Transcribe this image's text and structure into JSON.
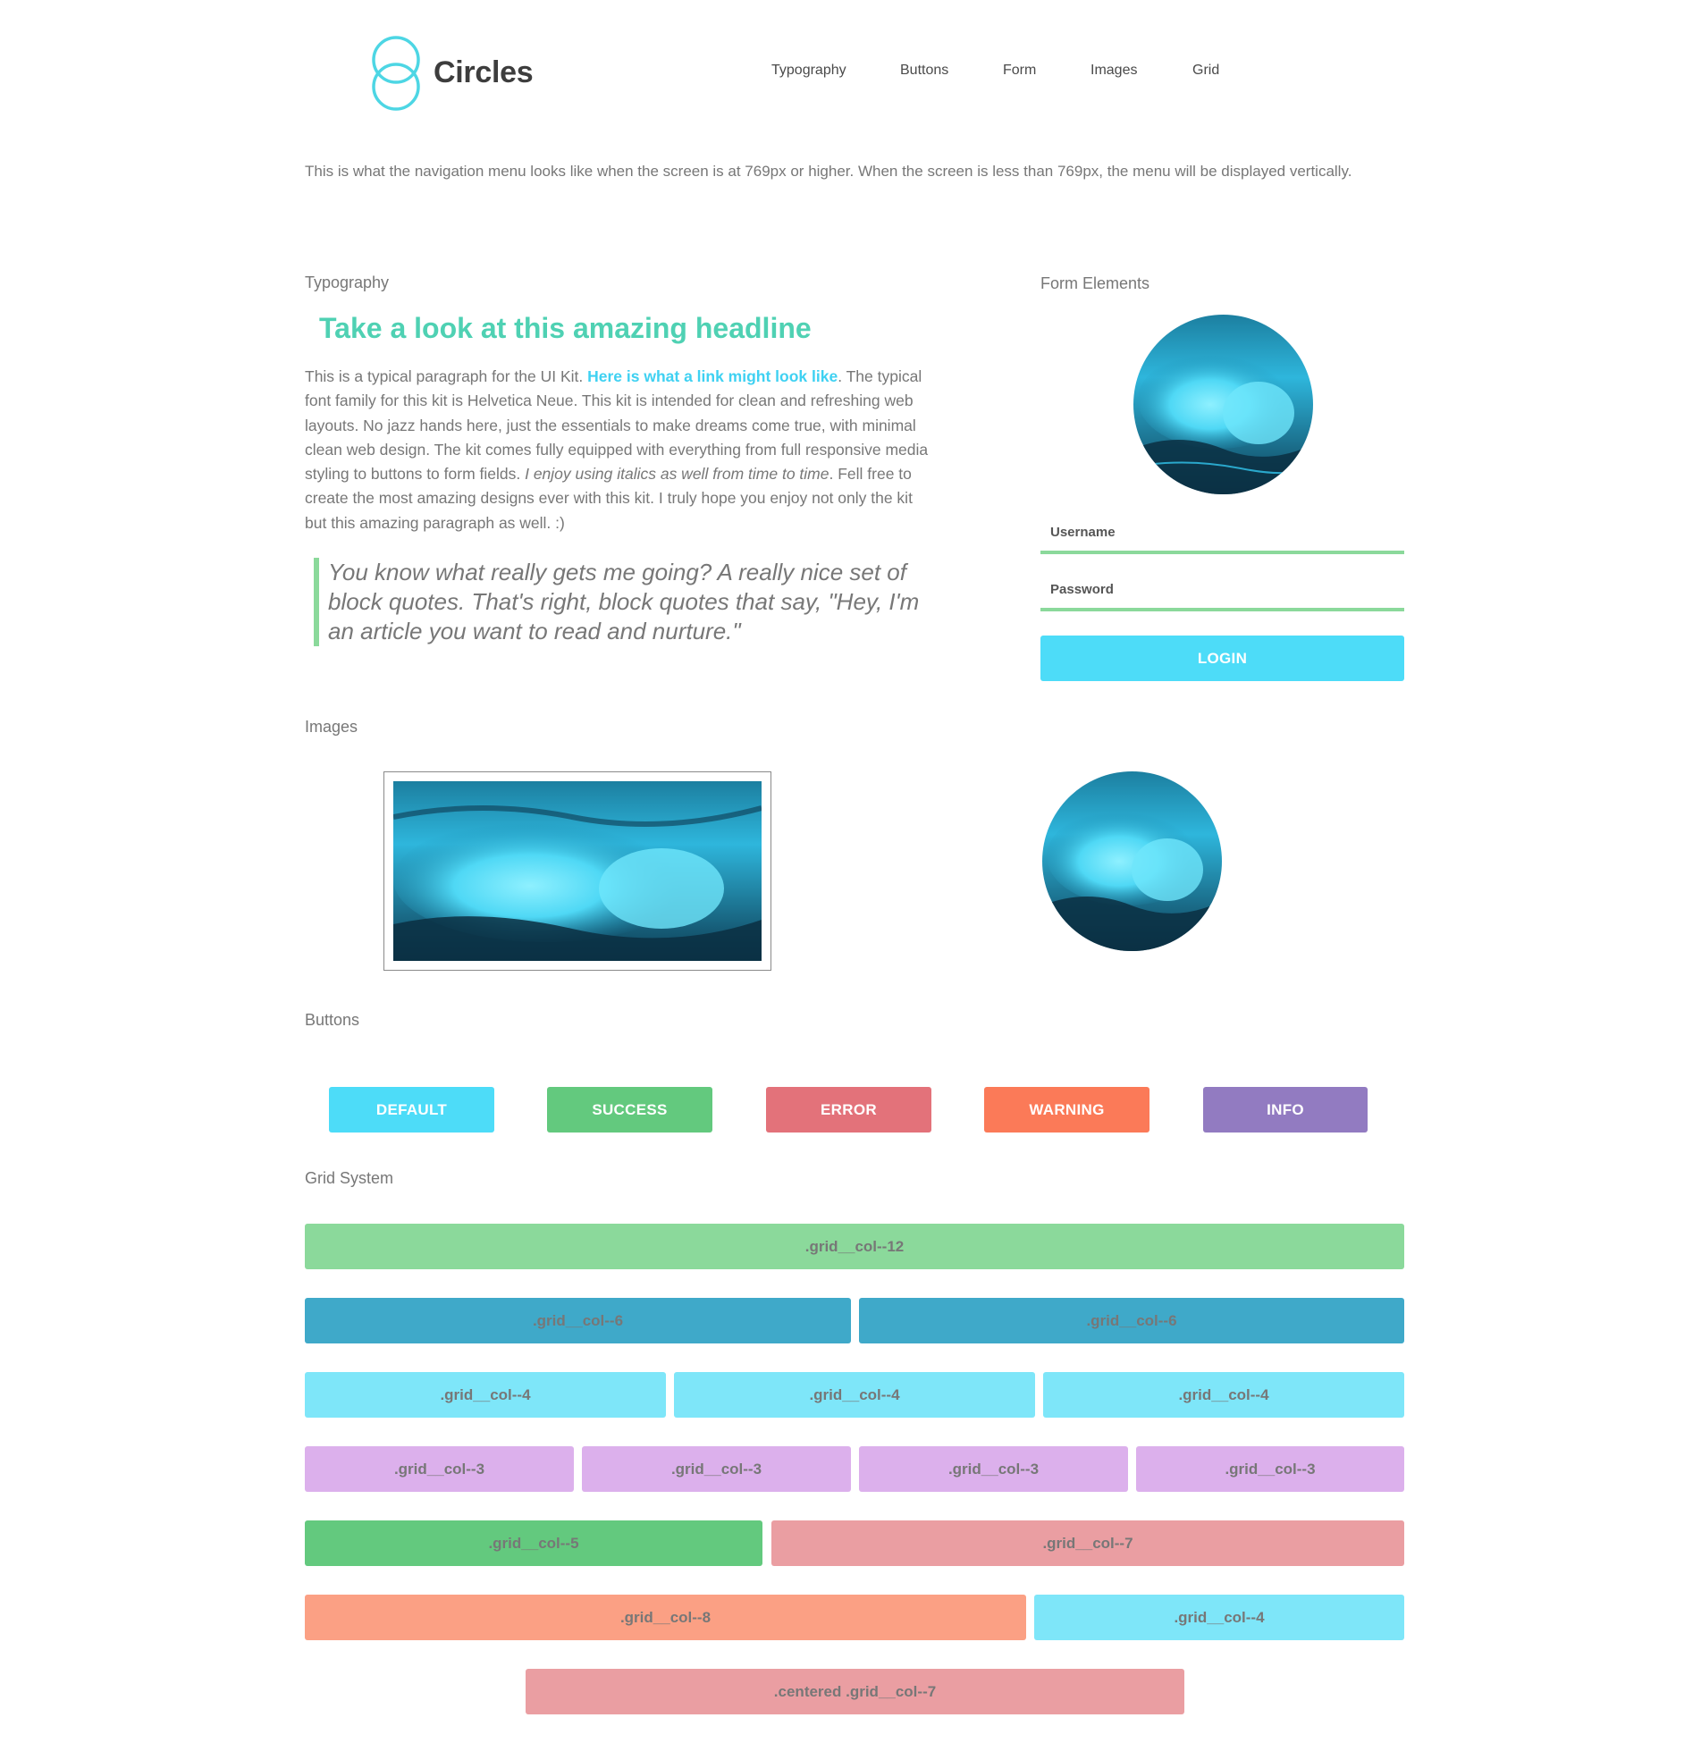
{
  "brand": {
    "name": "Circles",
    "color": "#4dd6e4"
  },
  "nav": {
    "items": [
      "Typography",
      "Buttons",
      "Form",
      "Images",
      "Grid"
    ]
  },
  "intro": {
    "text": "This is what the navigation menu looks like when the screen is at 769px or higher. When the screen is less than 769px, the menu will be displayed vertically."
  },
  "typography": {
    "label": "Typography",
    "headline": "Take a look at this amazing headline",
    "paragraph": {
      "part1": "This is a typical paragraph for the UI Kit. ",
      "link": "Here is what a link might look like",
      "part2": ". The typical font family for this kit is Helvetica Neue. This kit is intended for clean and refreshing web layouts. No jazz hands here, just the essentials to make dreams come true, with minimal clean web design. The kit comes fully equipped with everything from full responsive media styling to buttons to form fields. ",
      "italic": "I enjoy using italics as well from time to time",
      "part3": ". Fell free to create the most amazing designs ever with this kit. I truly hope you enjoy not only the kit but this amazing paragraph as well. :)"
    },
    "blockquote": "You know what really gets me going? A really nice set of block quotes. That's right, block quotes that say, \"Hey, I'm an article you want to read and nurture.\""
  },
  "form": {
    "label": "Form Elements",
    "username_placeholder": "Username",
    "password_placeholder": "Password",
    "login_label": "LOGIN"
  },
  "images": {
    "label": "Images"
  },
  "buttons": {
    "label": "Buttons",
    "items": [
      {
        "label": "DEFAULT",
        "color": "#4ddcf8"
      },
      {
        "label": "SUCCESS",
        "color": "#63c97e"
      },
      {
        "label": "ERROR",
        "color": "#e3727a"
      },
      {
        "label": "WARNING",
        "color": "#fb7a58"
      },
      {
        "label": "INFO",
        "color": "#927bc1"
      }
    ]
  },
  "grid": {
    "label": "Grid System",
    "rows": [
      [
        {
          "label": ".grid__col--12",
          "color": "#8bd99b"
        }
      ],
      [
        {
          "label": ".grid__col--6",
          "color": "#3fa9c9"
        },
        {
          "label": ".grid__col--6",
          "color": "#3fa9c9"
        }
      ],
      [
        {
          "label": ".grid__col--4",
          "color": "#7ee6f9"
        },
        {
          "label": ".grid__col--4",
          "color": "#7ee6f9"
        },
        {
          "label": ".grid__col--4",
          "color": "#7ee6f9"
        }
      ],
      [
        {
          "label": ".grid__col--3",
          "color": "#dcb0ec"
        },
        {
          "label": ".grid__col--3",
          "color": "#dcb0ec"
        },
        {
          "label": ".grid__col--3",
          "color": "#dcb0ec"
        },
        {
          "label": ".grid__col--3",
          "color": "#dcb0ec"
        }
      ],
      [
        {
          "label": ".grid__col--5",
          "color": "#63c97e"
        },
        {
          "label": ".grid__col--7",
          "color": "#ea9ea2"
        }
      ],
      [
        {
          "label": ".grid__col--8",
          "color": "#fba084"
        },
        {
          "label": ".grid__col--4",
          "color": "#7ee6f9"
        }
      ],
      [
        {
          "label": ".centered .grid__col--7",
          "color": "#ea9ea2"
        }
      ]
    ]
  }
}
